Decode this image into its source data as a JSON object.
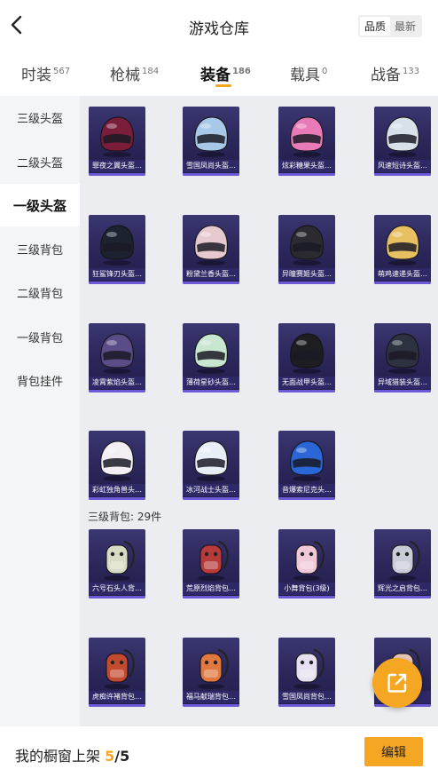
{
  "header": {
    "title": "游戏仓库",
    "back_icon": "chevron-left-icon",
    "sort_options": [
      "品质",
      "最新"
    ],
    "sort_selected": "品质"
  },
  "tabs": [
    {
      "label": "时装",
      "count": "567"
    },
    {
      "label": "枪械",
      "count": "184"
    },
    {
      "label": "装备",
      "count": "186",
      "active": true
    },
    {
      "label": "载具",
      "count": "0"
    },
    {
      "label": "战备",
      "count": "133"
    }
  ],
  "sidebar": {
    "items": [
      {
        "label": "三级头盔"
      },
      {
        "label": "二级头盔"
      },
      {
        "label": "一级头盔",
        "active": true
      },
      {
        "label": "三级背包"
      },
      {
        "label": "二级背包"
      },
      {
        "label": "一级背包"
      },
      {
        "label": "背包挂件"
      }
    ]
  },
  "helmets": [
    {
      "name": "罪夜之翼头盔…",
      "color": "#7a1d3a"
    },
    {
      "name": "雪国凤尚头盔…",
      "color": "#a8c8e8"
    },
    {
      "name": "炫彩糖果头盔…",
      "color": "#e87ab8"
    },
    {
      "name": "风速短诗头盔…",
      "color": "#d8e0ea"
    },
    {
      "name": "狂鲨锋刃头盔…",
      "color": "#1c2230"
    },
    {
      "name": "粉黛兰香头盔…",
      "color": "#e6c8cf"
    },
    {
      "name": "异瞳赛姬头盔…",
      "color": "#2a2a30"
    },
    {
      "name": "萌鸡速递头盔…",
      "color": "#e8c064"
    },
    {
      "name": "凌霄紫焰头盔…",
      "color": "#5a4c86"
    },
    {
      "name": "薄荷星砂头盔…",
      "color": "#c8e6d0"
    },
    {
      "name": "无面战甲头盔…",
      "color": "#1e1e22"
    },
    {
      "name": "异域猎装头盔…",
      "color": "#2c3240"
    },
    {
      "name": "彩虹独角兽头…",
      "color": "#f2eef4"
    },
    {
      "name": "冰河战士头盔…",
      "color": "#e8eef6"
    },
    {
      "name": "音爆索尼克头…",
      "color": "#2a66d6"
    }
  ],
  "section": {
    "label": "三级背包: 29件"
  },
  "backpacks": [
    {
      "name": "六号石头人背…",
      "color": "#d8dcc4"
    },
    {
      "name": "荒原烈焰背包…",
      "color": "#b83a3a"
    },
    {
      "name": "小舞背包(3级)",
      "color": "#f0c8d8"
    },
    {
      "name": "辉光之启背包…",
      "color": "#c8ccd8"
    },
    {
      "name": "虎痴许褚背包…",
      "color": "#c24a2e"
    },
    {
      "name": "福马献瑞背包…",
      "color": "#e07840"
    },
    {
      "name": "雪国凤尚背包…",
      "color": "#e8e0f0"
    },
    {
      "name": "",
      "color": "#e8c4b8"
    }
  ],
  "bottom": {
    "showcase_label": "我的橱窗上架",
    "current": "5",
    "separator": "/",
    "max": "5",
    "edit_label": "编辑"
  },
  "fab": {
    "icon": "share-external-icon"
  },
  "colors": {
    "accent": "#f5a623",
    "card_bg": "#2a2659",
    "card_bar": "#6d5ad6"
  }
}
